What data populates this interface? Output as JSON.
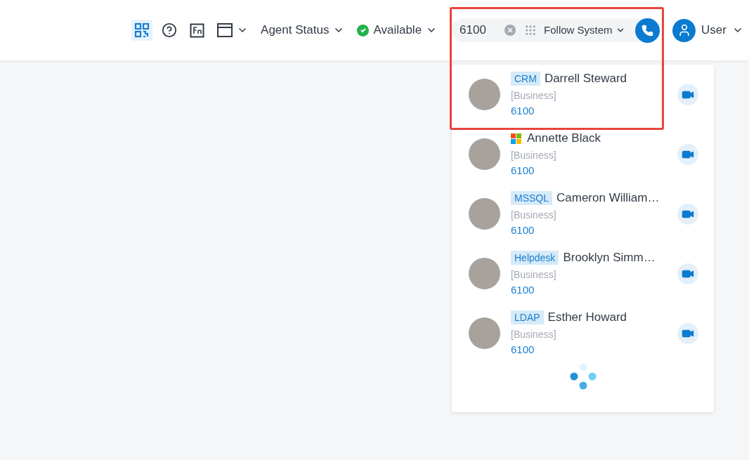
{
  "header": {
    "agent_status": "Agent Status",
    "presence": {
      "label": "Available",
      "color": "#22b14c"
    },
    "search": {
      "value": "6100",
      "mode": "Follow System"
    },
    "user": "User"
  },
  "results": [
    {
      "source": {
        "kind": "tag",
        "label": "CRM"
      },
      "name": "Darrell Steward",
      "group": "[Business]",
      "number": "6100",
      "highlighted": true
    },
    {
      "source": {
        "kind": "microsoft"
      },
      "name": "Annette Black",
      "group": "[Business]",
      "number": "6100",
      "highlighted": false
    },
    {
      "source": {
        "kind": "tag",
        "label": "MSSQL"
      },
      "name": "Cameron William…",
      "group": "[Business]",
      "number": "6100",
      "highlighted": false
    },
    {
      "source": {
        "kind": "tag",
        "label": "Helpdesk"
      },
      "name": "Brooklyn Simm…",
      "group": "[Business]",
      "number": "6100",
      "highlighted": false
    },
    {
      "source": {
        "kind": "tag",
        "label": "LDAP"
      },
      "name": "Esther Howard",
      "group": "[Business]",
      "number": "6100",
      "highlighted": false
    }
  ],
  "loading": true
}
